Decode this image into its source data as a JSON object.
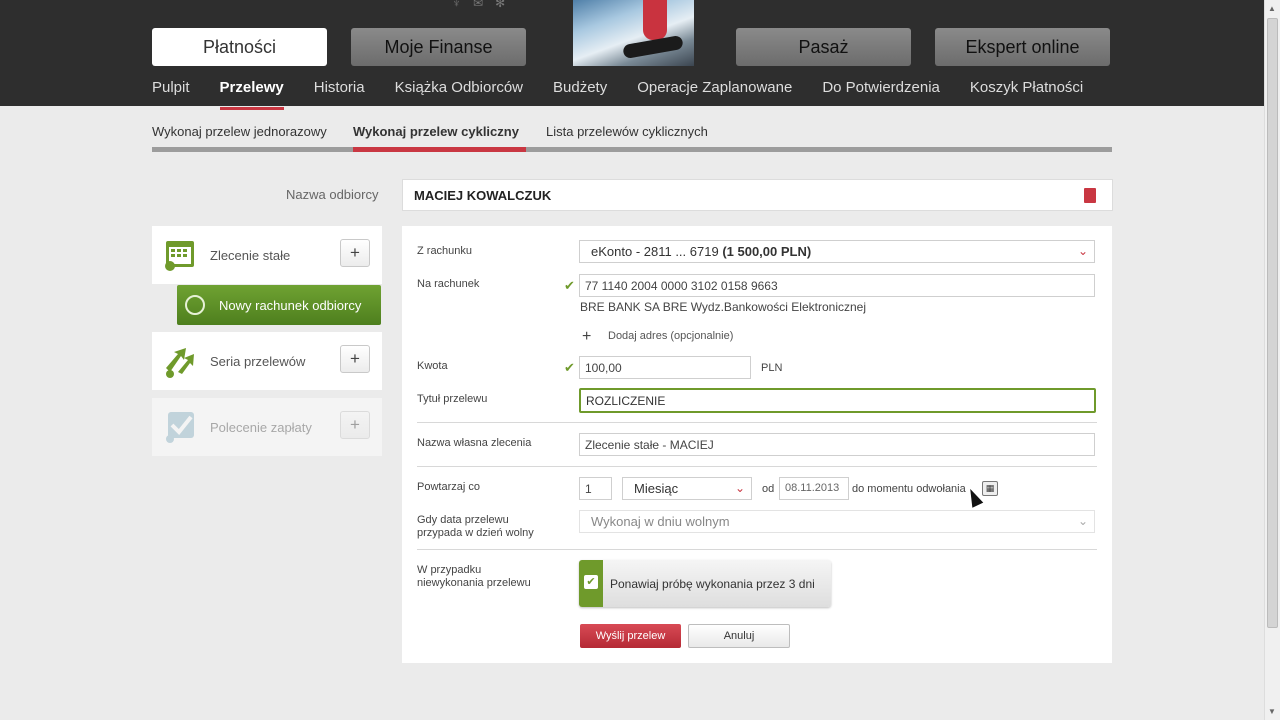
{
  "header": {
    "main_tabs": [
      "Płatności",
      "Moje Finanse",
      "Pasaż",
      "Ekspert online"
    ],
    "active_main_tab": "Płatności",
    "subnav": [
      "Pulpit",
      "Przelewy",
      "Historia",
      "Książka Odbiorców",
      "Budżety",
      "Operacje Zaplanowane",
      "Do Potwierdzenia",
      "Koszyk Płatności"
    ],
    "active_subnav": "Przelewy"
  },
  "transfer_tabs": [
    "Wykonaj przelew jednorazowy",
    "Wykonaj przelew cykliczny",
    "Lista przelewów cyklicznych"
  ],
  "recipient": {
    "label": "Nazwa odbiorcy",
    "value": "MACIEJ KOWALCZUK"
  },
  "left_panel": {
    "zlecenie": "Zlecenie stałe",
    "nowy_rachunek": "Nowy rachunek odbiorcy",
    "seria": "Seria przelewów",
    "polecenie": "Polecenie zapłaty",
    "plus": "+"
  },
  "form": {
    "z_rachunku_label": "Z rachunku",
    "z_rachunku_value": "eKonto - 2811 ... 6719 ",
    "z_rachunku_amount": "(1 500,00 PLN)",
    "na_rachunek_label": "Na rachunek",
    "na_rachunek_value": "77 1140 2004 0000 3102 0158 9663",
    "bank_name": "BRE BANK SA BRE Wydz.Bankowości Elektronicznej",
    "dodaj_adres": "Dodaj adres (opcjonalnie)",
    "kwota_label": "Kwota",
    "kwota_value": "100,00",
    "currency": "PLN",
    "tytul_label": "Tytuł przelewu",
    "tytul_value": "ROZLICZENIE",
    "nazwa_wlasna_label": "Nazwa własna zlecenia",
    "nazwa_wlasna_value": "Zlecenie stałe - MACIEJ",
    "powtarzaj_label": "Powtarzaj co",
    "powtarzaj_value": "1",
    "period": "Miesiąc",
    "od": "od",
    "date": "08.11.2013",
    "do_momentu": "do momentu odwołania",
    "gdy_data_label_1": "Gdy data przelewu",
    "gdy_data_label_2": "przypada w dzień wolny",
    "gdy_data_value": "Wykonaj w dniu wolnym",
    "niewykonania_label_1": "W przypadku",
    "niewykonania_label_2": "niewykonania przelewu",
    "ponawiaj": "Ponawiaj próbę wykonania przez 3 dni",
    "send": "Wyślij przelew",
    "cancel": "Anuluj"
  }
}
